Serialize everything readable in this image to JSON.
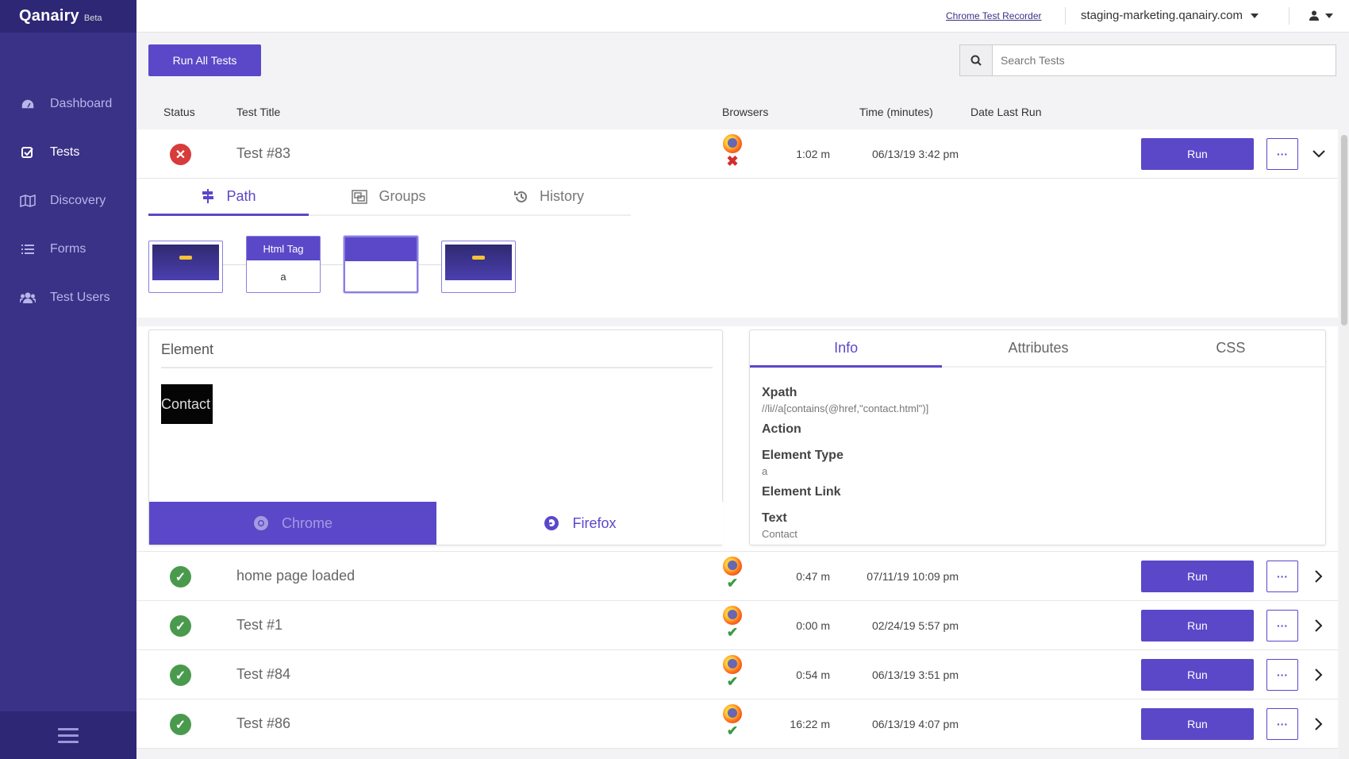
{
  "app": {
    "brand": "Qanairy",
    "badge": "Beta"
  },
  "nav": [
    {
      "label": "Dashboard",
      "icon": "dashboard-icon"
    },
    {
      "label": "Tests",
      "icon": "check-square-icon",
      "active": true
    },
    {
      "label": "Discovery",
      "icon": "map-icon"
    },
    {
      "label": "Forms",
      "icon": "list-icon"
    },
    {
      "label": "Test Users",
      "icon": "users-icon"
    }
  ],
  "topbar": {
    "recorder_link": "Chrome Test Recorder",
    "site": "staging-marketing.qanairy.com"
  },
  "toolbar": {
    "run_all": "Run All Tests",
    "search_placeholder": "Search Tests"
  },
  "columns": {
    "status": "Status",
    "title": "Test Title",
    "browsers": "Browsers",
    "time": "Time (minutes)",
    "date": "Date Last Run"
  },
  "run_label": "Run",
  "more_label": "···",
  "tests": [
    {
      "status": "fail",
      "title": "Test #83",
      "browser": "firefox",
      "result": "fail",
      "time": "1:02 m",
      "date": "06/13/19 3:42 pm",
      "expanded": true
    },
    {
      "status": "pass",
      "title": "home page loaded",
      "browser": "firefox",
      "result": "pass",
      "time": "0:47 m",
      "date": "07/11/19 10:09 pm"
    },
    {
      "status": "pass",
      "title": "Test #1",
      "browser": "firefox",
      "result": "pass",
      "time": "0:00 m",
      "date": "02/24/19 5:57 pm"
    },
    {
      "status": "pass",
      "title": "Test #84",
      "browser": "firefox",
      "result": "pass",
      "time": "0:54 m",
      "date": "06/13/19 3:51 pm"
    },
    {
      "status": "pass",
      "title": "Test #86",
      "browser": "firefox",
      "result": "pass",
      "time": "16:22 m",
      "date": "06/13/19 4:07 pm"
    }
  ],
  "detail": {
    "tabs": [
      "Path",
      "Groups",
      "History"
    ],
    "path_steps": [
      {
        "type": "screenshot"
      },
      {
        "type": "element",
        "header": "Html Tag",
        "value": "a"
      },
      {
        "type": "action",
        "header": "",
        "value": ""
      },
      {
        "type": "screenshot"
      }
    ],
    "element_card": {
      "title": "Element",
      "preview_text": "Contact",
      "browsers": [
        "Chrome",
        "Firefox"
      ]
    },
    "info_tabs": [
      "Info",
      "Attributes",
      "CSS"
    ],
    "info_fields": [
      {
        "label": "Xpath",
        "value": "//li//a[contains(@href,\"contact.html\")]"
      },
      {
        "label": "Action",
        "value": ""
      },
      {
        "label": "Element Type",
        "value": "a"
      },
      {
        "label": "Element Link",
        "value": ""
      },
      {
        "label": "Text",
        "value": "Contact"
      }
    ]
  },
  "colors": {
    "sidebar": "#3a3286",
    "accent": "#5a48c9",
    "fail": "#d83b3b",
    "pass": "#4a9a4e"
  }
}
